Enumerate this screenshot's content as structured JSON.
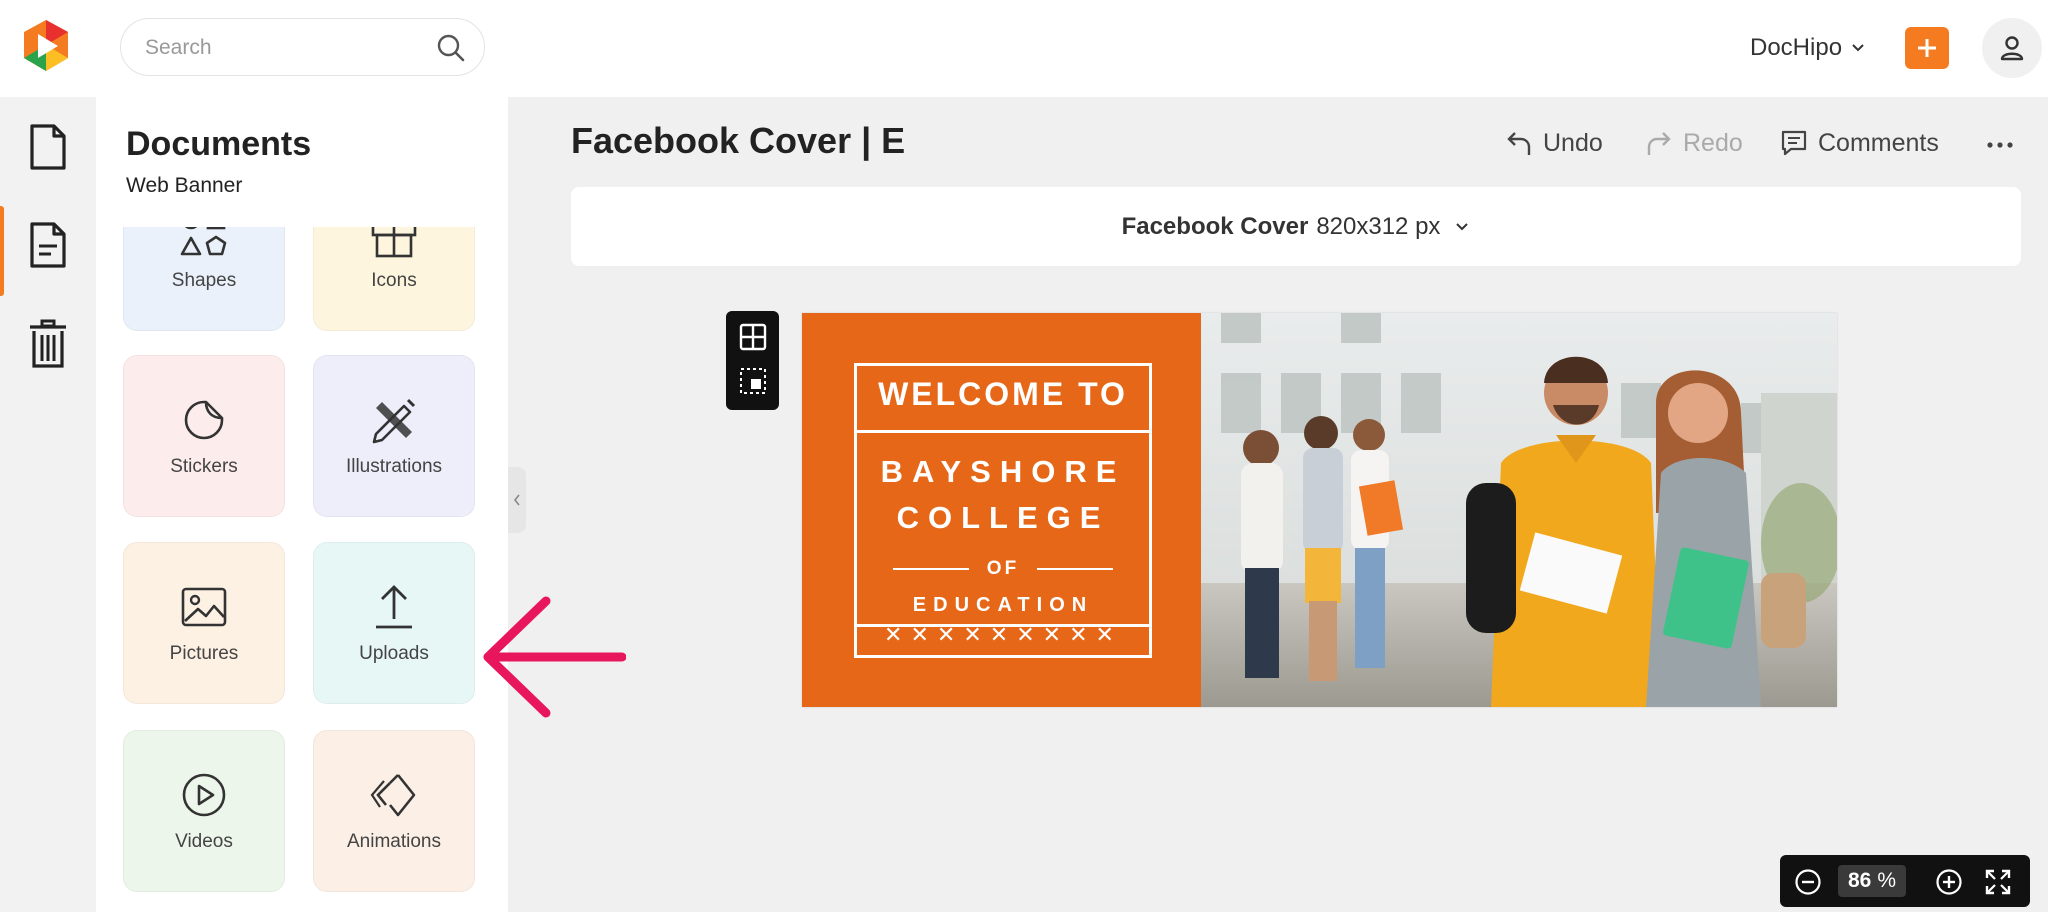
{
  "search": {
    "placeholder": "Search"
  },
  "header": {
    "brand": "DocHipo"
  },
  "colors": {
    "accent": "#f47b20",
    "banner_orange": "#e66717",
    "arrow": "#e8175d"
  },
  "rail": [
    {
      "name": "documents-icon"
    },
    {
      "name": "document-list-icon"
    },
    {
      "name": "trash-icon"
    }
  ],
  "panel": {
    "title": "Documents",
    "subtitle": "Web Banner",
    "tiles": [
      {
        "label": "Shapes",
        "icon": "shapes-icon",
        "color": "#eaf1fb"
      },
      {
        "label": "Icons",
        "icon": "gift-icon",
        "color": "#fdf5de"
      },
      {
        "label": "Stickers",
        "icon": "sticker-icon",
        "color": "#fdecec"
      },
      {
        "label": "Illustrations",
        "icon": "pencil-ruler-icon",
        "color": "#eeeefb"
      },
      {
        "label": "Pictures",
        "icon": "image-icon",
        "color": "#fdf1e3"
      },
      {
        "label": "Uploads",
        "icon": "upload-icon",
        "color": "#e6f7f6"
      },
      {
        "label": "Videos",
        "icon": "play-icon",
        "color": "#edf6ea"
      },
      {
        "label": "Animations",
        "icon": "animation-icon",
        "color": "#fcefe5"
      }
    ]
  },
  "document": {
    "title": "Facebook Cover | E",
    "size_name": "Facebook Cover",
    "size_dims": "820x312 px"
  },
  "toolbar": {
    "undo": "Undo",
    "redo": "Redo",
    "comments": "Comments"
  },
  "banner": {
    "line1": "WELCOME TO",
    "line2": "BAYSHORE",
    "line3": "COLLEGE",
    "line4": "OF",
    "line5": "EDUCATION",
    "ornament": "✕✕✕✕✕✕✕✕✕"
  },
  "zoom": {
    "value": "86",
    "unit": "%"
  }
}
